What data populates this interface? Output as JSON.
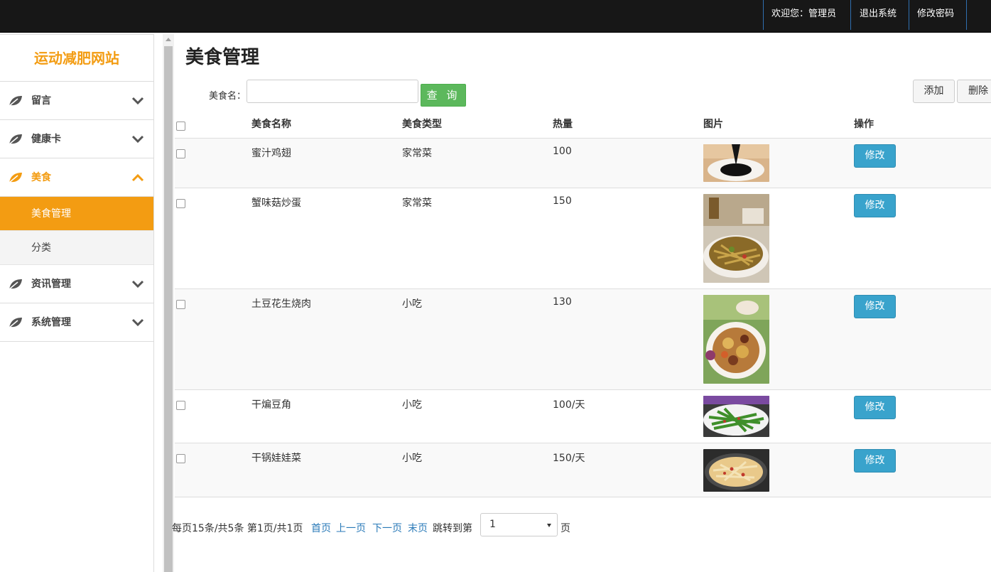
{
  "topbar": {
    "welcome": "欢迎您：管理员",
    "logout": "退出系统",
    "change_password": "修改密码"
  },
  "sidebar": {
    "brand": "运动减肥网站",
    "accent_color": "#f39c12",
    "menu": [
      {
        "label": "留言",
        "icon": "leaf-icon",
        "expanded": false
      },
      {
        "label": "健康卡",
        "icon": "leaf-icon",
        "expanded": false
      },
      {
        "label": "美食",
        "icon": "leaf-icon",
        "expanded": true,
        "children": [
          {
            "label": "美食管理",
            "active": true
          },
          {
            "label": "分类",
            "active": false
          }
        ]
      },
      {
        "label": "资讯管理",
        "icon": "leaf-icon",
        "expanded": false
      },
      {
        "label": "系统管理",
        "icon": "leaf-icon",
        "expanded": false
      }
    ]
  },
  "main": {
    "title": "美食管理",
    "search": {
      "label": "美食名：",
      "value": "",
      "button": "查 询"
    },
    "toolbar": {
      "add": "添加",
      "delete": "删除"
    },
    "table": {
      "headers": [
        "美食名称",
        "美食类型",
        "热量",
        "图片",
        "操作"
      ],
      "rows": [
        {
          "name": "蜜汁鸡翅",
          "type": "家常菜",
          "calories": "100",
          "image": "sauce-pour-photo",
          "action": "修改"
        },
        {
          "name": "蟹味菇炒蛋",
          "type": "家常菜",
          "calories": "150",
          "image": "stir-fry-plate-photo",
          "action": "修改"
        },
        {
          "name": "土豆花生烧肉",
          "type": "小吃",
          "calories": "130",
          "image": "potato-pork-bowl-photo",
          "action": "修改"
        },
        {
          "name": "干煸豆角",
          "type": "小吃",
          "calories": "100/天",
          "image": "green-beans-photo",
          "action": "修改"
        },
        {
          "name": "干锅娃娃菜",
          "type": "小吃",
          "calories": "150/天",
          "image": "cabbage-pot-photo",
          "action": "修改"
        }
      ]
    },
    "pager": {
      "summary": "每页15条/共5条 第1页/共1页",
      "first": "首页",
      "prev": "上一页",
      "next": "下一页",
      "last": "末页",
      "jump_label": "跳转到第",
      "page_value": "1",
      "page_suffix": "页"
    }
  }
}
